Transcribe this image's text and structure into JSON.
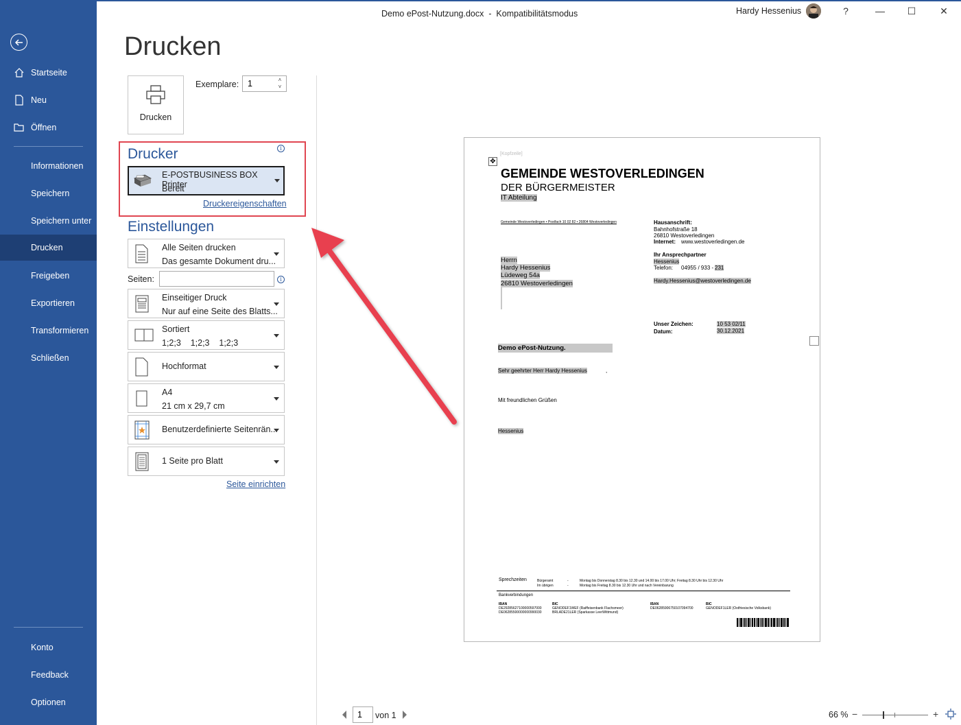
{
  "titlebar": {
    "title": "Demo ePost-Nutzung.docx  -  Kompatibilitätsmodus",
    "user": "Hardy Hessenius",
    "help": "?",
    "minimize": "—",
    "maximize": "☐",
    "close": "✕"
  },
  "sidebar": {
    "items": [
      {
        "label": "Startseite"
      },
      {
        "label": "Neu"
      },
      {
        "label": "Öffnen"
      },
      {
        "label": "Informationen"
      },
      {
        "label": "Speichern"
      },
      {
        "label": "Speichern unter"
      },
      {
        "label": "Drucken"
      },
      {
        "label": "Freigeben"
      },
      {
        "label": "Exportieren"
      },
      {
        "label": "Transformieren"
      },
      {
        "label": "Schließen"
      },
      {
        "label": "Konto"
      },
      {
        "label": "Feedback"
      },
      {
        "label": "Optionen"
      }
    ]
  },
  "print": {
    "page_title": "Drucken",
    "button_label": "Drucken",
    "copies_label": "Exemplare:",
    "copies_value": "1"
  },
  "printer": {
    "heading": "Drucker",
    "name": "E-POSTBUSINESS BOX Printer",
    "status": "Bereit",
    "properties_link": "Druckereigenschaften"
  },
  "settings": {
    "heading": "Einstellungen",
    "pages_label": "Seiten:",
    "pages_value": "",
    "page_setup_link": "Seite einrichten",
    "dropdowns": [
      {
        "l1": "Alle Seiten drucken",
        "l2": "Das gesamte Dokument dru..."
      },
      {
        "l1": "Einseitiger Druck",
        "l2": "Nur auf eine Seite des Blatts..."
      },
      {
        "l1": "Sortiert",
        "l2": "1;2;3    1;2;3    1;2;3"
      },
      {
        "l1": "Hochformat"
      },
      {
        "l1": "A4",
        "l2": "21 cm x 29,7 cm"
      },
      {
        "l1": "Benutzerdefinierte Seitenrän..."
      },
      {
        "l1": "1 Seite pro Blatt"
      }
    ]
  },
  "preview": {
    "header_hint": "[Kopfzeile]",
    "org_title": "GEMEINDE WESTOVERLEDINGEN",
    "org_sub": "DER BÜRGERMEISTER",
    "department": "IT Abteilung",
    "sender_line": "Gemeinde Westoverledingen • Postfach 10 02 82 • 26804 Westoverledingen",
    "address_heading": "Hausanschrift:",
    "address_street": "Bahnhofstraße 18",
    "address_city": "26810 Westoverledingen",
    "internet_label": "Internet:",
    "internet_value": "www.westoverledingen.de",
    "contact_heading": "Ihr Ansprechpartner",
    "contact_name": "Hessenius",
    "phone_label": "Telefon:",
    "phone_value": "04955 / 933 - ",
    "phone_ext": "231",
    "email": "Hardy.Hessenius@westoverledingen.de",
    "recipient": [
      "Herrn",
      "Hardy Hessenius",
      "Lüdeweg 54a",
      "26810 Westoverledingen"
    ],
    "ref_label": "Unser Zeichen:",
    "ref_value": "10 53 02/11",
    "date_label": "Datum:",
    "date_value": "30.12.2021",
    "subject": "Demo ePost-Nutzung.",
    "salutation": "Sehr geehrter Herr Hardy Hessenius",
    "salutation_end": ",",
    "closing": "Mit freundlichen Grüßen",
    "signature": "Hessenius",
    "footer_hours_label": "Sprechzeiten",
    "footer_dept1": "Bürgeramt",
    "footer_dept2": "Im übrigen",
    "footer_dash": "-",
    "footer_hours1": "Montag bis Donnerstag 8.30 bis 12.30 und 14.00 bis 17.00 Uhr; Freitag 8.30 Uhr bis 12.30 Uhr",
    "footer_hours2": "Montag bis Freitag 8.30 bis 12.30 Uhr und nach Vereinbarung",
    "bank_label": "Bankverbindungen",
    "iban_label": "IBAN",
    "bic_label": "BIC",
    "iban1": "DE29285627100000597000",
    "iban2": "DE06285500000000990030",
    "bic1": "GENODEF1WEF (Raiffeisenbank Flachsmeer)",
    "bic2": "BRLADE21LER (Sparkasse LeerWittmund)",
    "iban3": "DE06285906750107094700",
    "bic3": "GENODEF1LER (Ostfriesische Volksbank)"
  },
  "bottombar": {
    "page_value": "1",
    "page_of": "von 1",
    "zoom": "66 %",
    "zoom_minus": "−",
    "zoom_plus": "+"
  },
  "colors": {
    "accent": "#2b579a",
    "sidebar_active": "#1e3f74",
    "highlight_red": "#e04550"
  }
}
